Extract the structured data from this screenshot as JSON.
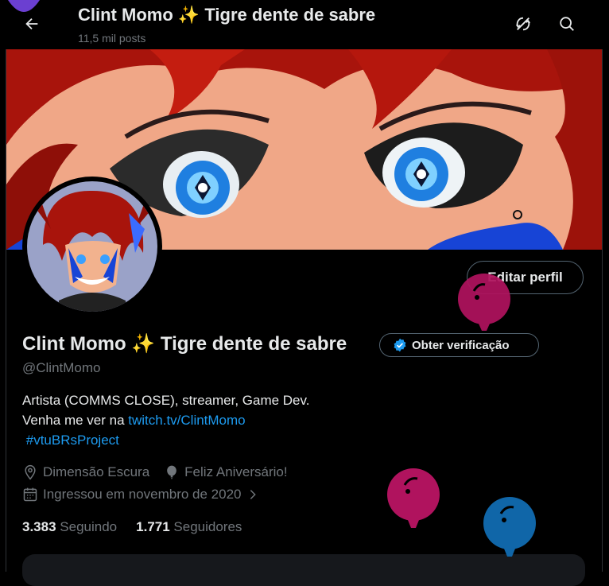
{
  "header": {
    "title": "Clint Momo ✨ Tigre dente de sabre",
    "post_count": "11,5 mil posts"
  },
  "profile": {
    "name": "Clint Momo ✨ Tigre dente de sabre",
    "handle": "@ClintMomo",
    "edit_label": "Editar perfil",
    "verify_label": "Obter verificação",
    "bio_line1": "Artista (COMMS CLOSE), streamer, Game Dev.",
    "bio_line2_prefix": "Venha me ver na ",
    "bio_link": "twitch.tv/ClintMomo",
    "bio_hashtag": "#vtuBRsProject",
    "location": "Dimensão Escura",
    "birthday": "Feliz Aniversário!",
    "joined": "Ingressou em novembro de 2020",
    "following_count": "3.383",
    "following_label": "Seguindo",
    "followers_count": "1.771",
    "followers_label": "Seguidores"
  },
  "colors": {
    "link": "#1d9bf0",
    "balloon_pink": "#b0135e",
    "balloon_blue": "#1066a8",
    "balloon_purple": "#6b3fd1"
  },
  "icons": [
    "back-arrow-icon",
    "no-sync-icon",
    "search-icon",
    "verified-badge-icon",
    "location-icon",
    "balloon-birthday-icon",
    "calendar-icon",
    "chevron-right-icon"
  ]
}
